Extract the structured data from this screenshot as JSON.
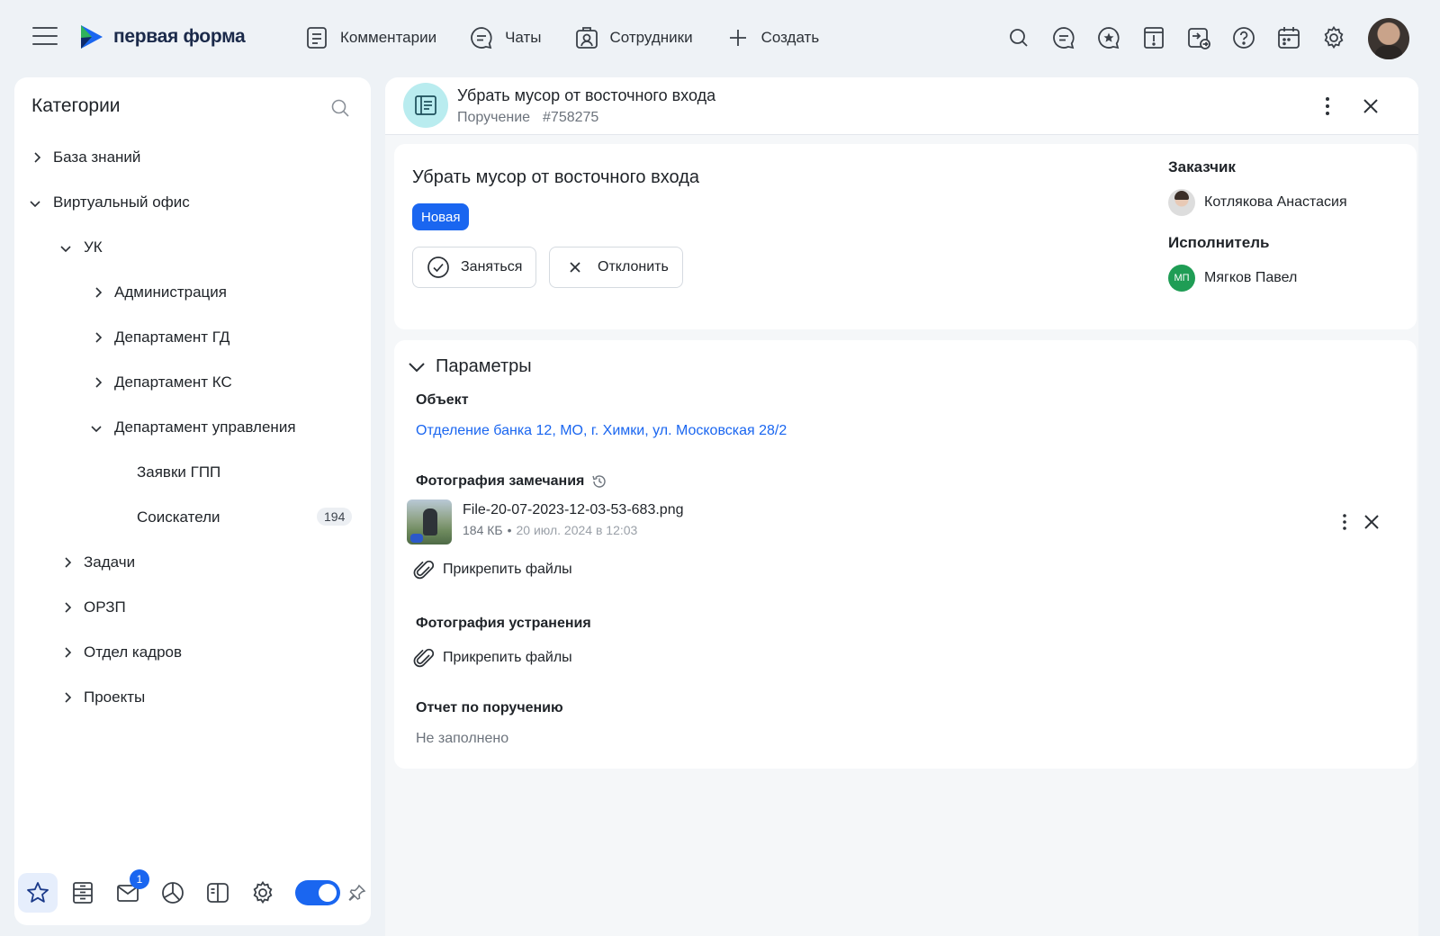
{
  "app": {
    "logo_text": "первая форма",
    "brand_colors": {
      "accent": "#1a66f0",
      "logo_green": "#2fb25b",
      "logo_blue": "#1a66f0"
    }
  },
  "topnav": {
    "items": [
      {
        "label": "Комментарии",
        "icon": "comment-doc-icon"
      },
      {
        "label": "Чаты",
        "icon": "chat-icon"
      },
      {
        "label": "Сотрудники",
        "icon": "employees-icon"
      },
      {
        "label": "Создать",
        "icon": "plus-icon"
      }
    ],
    "right_icons": [
      "search-icon",
      "chat-bubble-icon",
      "starred-chat-icon",
      "alert-doc-icon",
      "transfer-icon",
      "help-icon",
      "calendar-icon",
      "settings-icon"
    ]
  },
  "sidebar": {
    "title": "Категории",
    "tree": [
      {
        "label": "База знаний",
        "level": 0,
        "state": "collapsed"
      },
      {
        "label": "Виртуальный офис",
        "level": 0,
        "state": "expanded"
      },
      {
        "label": "УК",
        "level": 1,
        "state": "expanded"
      },
      {
        "label": "Администрация",
        "level": 2,
        "state": "collapsed"
      },
      {
        "label": "Департамент ГД",
        "level": 2,
        "state": "collapsed"
      },
      {
        "label": "Департамент КС",
        "level": 2,
        "state": "collapsed"
      },
      {
        "label": "Департамент управления",
        "level": 2,
        "state": "expanded"
      },
      {
        "label": "Заявки ГПП",
        "level": 3,
        "state": "leaf"
      },
      {
        "label": "Соискатели",
        "level": 3,
        "state": "leaf",
        "count": "194"
      },
      {
        "label": "Задачи",
        "level": 1,
        "state": "collapsed"
      },
      {
        "label": "ОРЗП",
        "level": 1,
        "state": "collapsed"
      },
      {
        "label": "Отдел кадров",
        "level": 1,
        "state": "collapsed"
      },
      {
        "label": "Проекты",
        "level": 1,
        "state": "collapsed"
      }
    ],
    "bottom": {
      "icons": [
        "star-icon",
        "registry-icon",
        "mail-icon",
        "reports-icon",
        "layout-icon",
        "settings-icon"
      ],
      "mail_badge": "1",
      "toggle_on": true
    }
  },
  "task": {
    "header_title": "Убрать мусор от восточного входа",
    "type": "Поручение",
    "number": "#758275",
    "title": "Убрать мусор от восточного входа",
    "status": "Новая",
    "actions": {
      "take": "Заняться",
      "reject": "Отклонить"
    },
    "customer_label": "Заказчик",
    "customer_name": "Котлякова Анастасия",
    "executor_label": "Исполнитель",
    "executor_initials": "МП",
    "executor_name": "Мягков Павел"
  },
  "params": {
    "title": "Параметры",
    "object_label": "Объект",
    "object_value": "Отделение банка 12, МО, г. Химки, ул. Московская 28/2",
    "photo_issue_label": "Фотография замечания",
    "file": {
      "name": "File-20-07-2023-12-03-53-683.png",
      "size": "184 КБ",
      "separator": "•",
      "date": "20 июл. 2024 в 12:03"
    },
    "attach_label": "Прикрепить файлы",
    "photo_fix_label": "Фотография устранения",
    "attach_label_2": "Прикрепить файлы",
    "report_label": "Отчет по поручению",
    "report_value": "Не заполнено"
  }
}
